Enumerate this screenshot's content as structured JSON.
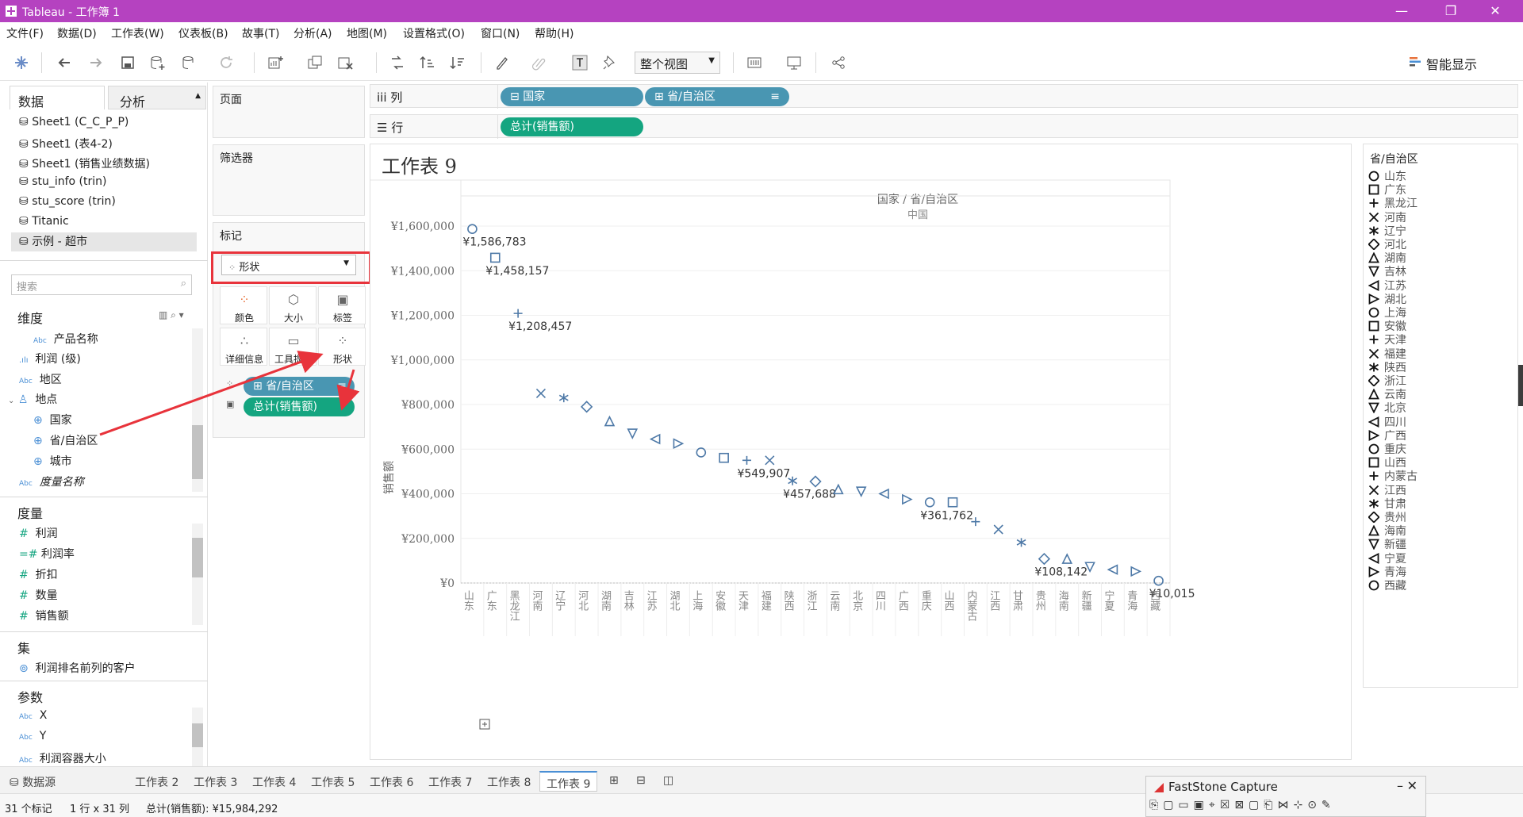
{
  "window": {
    "title": "Tableau - 工作簿 1"
  },
  "menu": [
    "文件(F)",
    "数据(D)",
    "工作表(W)",
    "仪表板(B)",
    "故事(T)",
    "分析(A)",
    "地图(M)",
    "设置格式(O)",
    "窗口(N)",
    "帮助(H)"
  ],
  "toolbar": {
    "view_select": "整个视图",
    "smart_show": "智能显示"
  },
  "left_panel": {
    "tab_data": "数据",
    "tab_analysis": "分析",
    "datasources": [
      "Sheet1 (C_C_P_P)",
      "Sheet1 (表4-2)",
      "Sheet1 (销售业绩数据)",
      "stu_info (trin)",
      "stu_score (trin)",
      "Titanic",
      "示例 - 超市"
    ],
    "search_placeholder": "搜索",
    "dimensions_title": "维度",
    "dimensions": [
      {
        "type": "Abc",
        "label": "产品名称"
      },
      {
        "type": "bin",
        "label": "利润 (级)"
      },
      {
        "type": "Abc",
        "label": "地区"
      },
      {
        "type": "hier",
        "label": "地点"
      },
      {
        "type": "geo",
        "label": "国家"
      },
      {
        "type": "geo",
        "label": "省/自治区"
      },
      {
        "type": "geo",
        "label": "城市"
      },
      {
        "type": "Abc",
        "label": "度量名称"
      }
    ],
    "measures_title": "度量",
    "measures": [
      "利润",
      "利润率",
      "折扣",
      "数量",
      "销售额"
    ],
    "sets_title": "集",
    "sets": [
      "利润排名前列的客户"
    ],
    "params_title": "参数",
    "params": [
      "X",
      "Y",
      "利润容器大小"
    ]
  },
  "cards": {
    "pages": "页面",
    "filters": "筛选器",
    "marks": "标记",
    "mark_type": "形状",
    "buttons": [
      "颜色",
      "大小",
      "标签",
      "详细信息",
      "工具提示",
      "形状"
    ],
    "pill_province": "省/自治区",
    "pill_sales": "总计(销售额)"
  },
  "shelves": {
    "cols_label": "列",
    "rows_label": "行",
    "col_pills": [
      "国家",
      "省/自治区"
    ],
    "row_pills": [
      "总计(销售额)"
    ]
  },
  "sheet": {
    "title": "工作表 9",
    "header_top": "国家 / 省/自治区",
    "header_sub": "中国",
    "yaxis_title": "销售额"
  },
  "chart_data": {
    "type": "scatter",
    "ylabel": "销售额",
    "ylim": [
      0,
      1650000
    ],
    "yticks": [
      "¥1,600,000",
      "¥1,400,000",
      "¥1,200,000",
      "¥1,000,000",
      "¥800,000",
      "¥600,000",
      "¥400,000",
      "¥200,000",
      "¥0"
    ],
    "ytick_values": [
      1600000,
      1400000,
      1200000,
      1000000,
      800000,
      600000,
      400000,
      200000,
      0
    ],
    "categories": [
      "山东",
      "广东",
      "黑龙江",
      "河南",
      "辽宁",
      "河北",
      "湖南",
      "吉林",
      "江苏",
      "湖北",
      "上海",
      "安徽",
      "天津",
      "福建",
      "陕西",
      "浙江",
      "云南",
      "北京",
      "四川",
      "广西",
      "重庆",
      "山西",
      "内蒙古",
      "江西",
      "甘肃",
      "贵州",
      "海南",
      "新疆",
      "宁夏",
      "青海",
      "西藏"
    ],
    "shapes": [
      "circle",
      "square",
      "plus",
      "cross",
      "asterisk",
      "diamond",
      "tri-up",
      "tri-down",
      "tri-left",
      "tri-right",
      "circle",
      "square",
      "plus",
      "cross",
      "asterisk",
      "diamond",
      "tri-up",
      "tri-down",
      "tri-left",
      "tri-right",
      "circle",
      "square",
      "plus",
      "cross",
      "asterisk",
      "diamond",
      "tri-up",
      "tri-down",
      "tri-left",
      "tri-right",
      "circle"
    ],
    "values": [
      1586783,
      1458157,
      1208457,
      850000,
      830000,
      790000,
      725000,
      670000,
      645000,
      625000,
      585000,
      561000,
      549907,
      549907,
      457688,
      455000,
      420000,
      410000,
      400000,
      375000,
      361762,
      361762,
      275000,
      240000,
      182000,
      108142,
      108142,
      72000,
      60000,
      52000,
      10015
    ],
    "data_labels": [
      "¥1,586,783",
      "¥1,458,157",
      "¥1,208,457",
      "",
      "",
      "",
      "",
      "",
      "",
      "",
      "",
      "",
      "¥549,907",
      "",
      "¥457,688",
      "",
      "",
      "",
      "",
      "",
      "¥361,762",
      "",
      "",
      "",
      "",
      "¥108,142",
      "",
      "",
      "",
      "",
      "¥10,015"
    ],
    "color": "#4e79a7"
  },
  "legend": {
    "title": "省/自治区"
  },
  "sheet_tabs": [
    "数据源",
    "工作表 2",
    "工作表 3",
    "工作表 4",
    "工作表 5",
    "工作表 6",
    "工作表 7",
    "工作表 8",
    "工作表 9"
  ],
  "status": {
    "marks": "31 个标记",
    "dims": "1 行 x 31 列",
    "sum": "总计(销售额): ¥15,984,292"
  },
  "faststone": {
    "title": "FastStone Capture"
  }
}
